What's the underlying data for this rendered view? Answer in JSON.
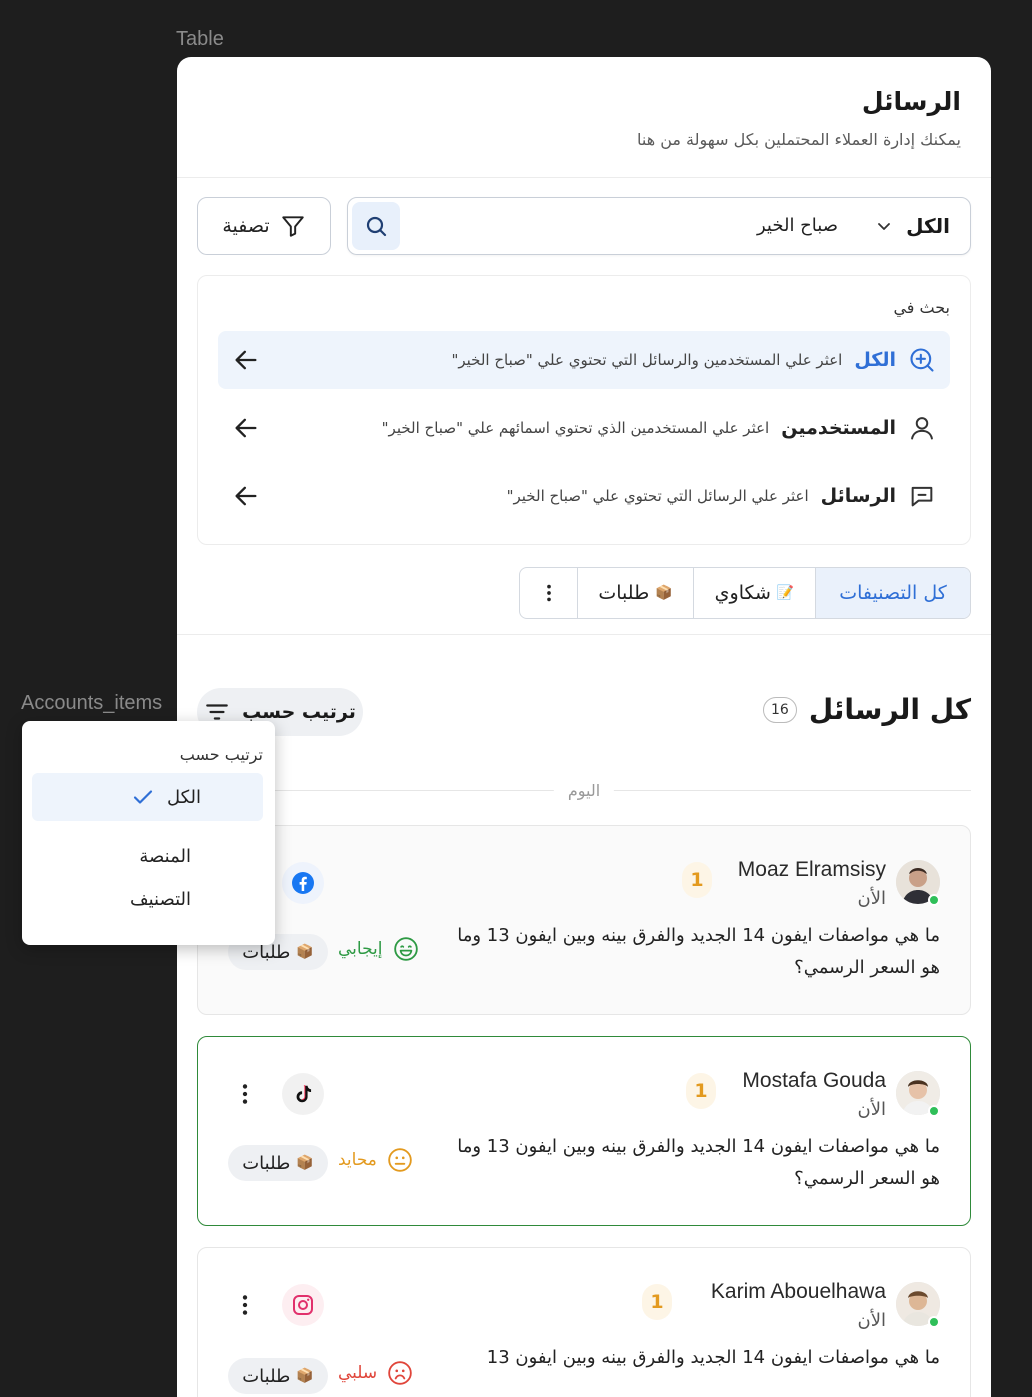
{
  "frame_labels": {
    "table": "Table",
    "accounts": "Accounts_items"
  },
  "header": {
    "title": "الرسائل",
    "subtitle": "يمكنك إدارة العملاء المحتملين بكل سهولة من هنا"
  },
  "search": {
    "scope": "الكل",
    "query": "صباح الخير",
    "filter_label": "تصفية"
  },
  "suggestions": {
    "heading": "بحث في",
    "items": [
      {
        "label": "الكل",
        "desc": "اعثر علي المستخدمين والرسائل التي تحتوي علي \"صباح الخير\"",
        "icon": "search-plus-icon"
      },
      {
        "label": "المستخدمين",
        "desc": "اعثر علي المستخدمين الذي تحتوي اسمائهم علي \"صباح الخير\"",
        "icon": "user-icon"
      },
      {
        "label": "الرسائل",
        "desc": "اعثر علي الرسائل التي تحتوي علي \"صباح الخير\"",
        "icon": "message-icon"
      }
    ]
  },
  "categories": {
    "items": [
      {
        "label": "كل التصنيفات",
        "emoji": ""
      },
      {
        "label": "شكاوي",
        "emoji": "📝"
      },
      {
        "label": "طلبات",
        "emoji": "📦"
      }
    ]
  },
  "list": {
    "title": "كل الرسائل",
    "count": "16",
    "sort_label": "ترتيب حسب",
    "day_label": "اليوم"
  },
  "messages": [
    {
      "name": "Moaz Elramsisy",
      "time": "الأن",
      "unread": "1",
      "text": "ما هي مواصفات ايفون 14 الجديد والفرق بينه وبين ايفون 13 وما هو السعر الرسمي؟",
      "platform": "facebook-icon",
      "sentiment": "إيجابي",
      "sentiment_color": "#2e9a44",
      "tag": "طلبات",
      "tag_emoji": "📦"
    },
    {
      "name": "Mostafa Gouda",
      "time": "الأن",
      "unread": "1",
      "text": "ما هي مواصفات ايفون 14 الجديد والفرق بينه وبين ايفون 13 وما هو السعر الرسمي؟",
      "platform": "tiktok-icon",
      "sentiment": "محايد",
      "sentiment_color": "#e39a1f",
      "tag": "طلبات",
      "tag_emoji": "📦"
    },
    {
      "name": "Karim Abouelhawa",
      "time": "الأن",
      "unread": "1",
      "text": "ما هي مواصفات ايفون 14 الجديد والفرق بينه وبين ايفون 13",
      "platform": "instagram-icon",
      "sentiment": "سلبي",
      "sentiment_color": "#e0453a",
      "tag": "طلبات",
      "tag_emoji": "📦"
    }
  ],
  "sort_dropdown": {
    "heading": "ترتيب حسب",
    "options": [
      {
        "label": "الكل",
        "selected": true
      },
      {
        "label": "المنصة",
        "selected": false
      },
      {
        "label": "التصنيف",
        "selected": false
      }
    ]
  },
  "colors": {
    "accent": "#2f6fd6",
    "selected_border": "#2f8a3a",
    "online": "#2fbf59"
  }
}
